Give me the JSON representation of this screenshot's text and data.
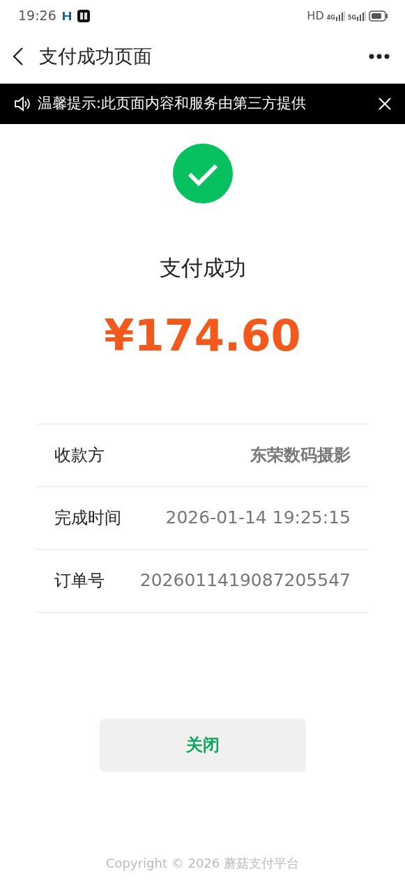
{
  "status_bar": {
    "time": "19:26",
    "network": "HD",
    "sim_1": "4G",
    "sim_2": "5G"
  },
  "header": {
    "title": "支付成功页面"
  },
  "notice": {
    "text": "温馨提示:此页面内容和服务由第三方提供"
  },
  "result": {
    "title": "支付成功",
    "amount": "¥174.60"
  },
  "details": [
    {
      "label": "收款方",
      "value": "东荣数码摄影",
      "emphasis": true
    },
    {
      "label": "完成时间",
      "value": "2026-01-14 19:25:15",
      "emphasis": false
    },
    {
      "label": "订单号",
      "value": "2026011419087205547",
      "emphasis": false
    }
  ],
  "close_button": {
    "label": "关闭"
  },
  "footer": {
    "text": "Copyright © 2026 蘑菇支付平台"
  }
}
